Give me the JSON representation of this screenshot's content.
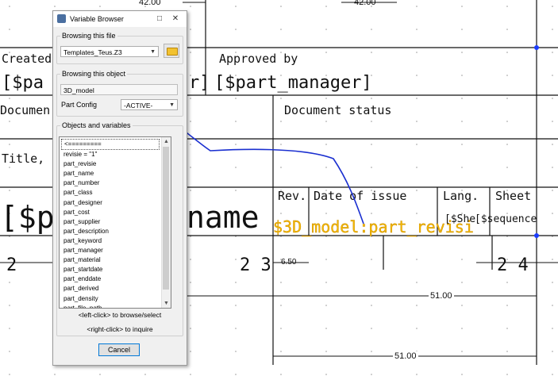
{
  "drawing": {
    "top_dims": [
      "42.00",
      "42.00"
    ],
    "created_label": "Created",
    "approved_label": "Approved by",
    "part_author_var": "[$pa",
    "bracket_r": "r]",
    "part_manager_var": "[$part_manager]",
    "document_type_label": "Documen",
    "document_status_label": "Document status",
    "title_label": "Title, Su",
    "rev_label": "Rev.",
    "date_issue_label": "Date of issue",
    "lang_label": "Lang.",
    "sheet_label": "Sheet",
    "name_prefix": "[$p",
    "name_suffix": "name",
    "lang_var": "[$She",
    "sheet_var": "[$sequence",
    "highlight_var": "$3D_model:part_revisi",
    "row_num_2": "2",
    "row_num_23": "2 3",
    "row_num_24": "2 4",
    "dim_650": "6.50",
    "dim_51a": "51.00",
    "dim_51b": "51.00"
  },
  "dialog": {
    "title": "Variable Browser",
    "browse_file_label": "Browsing this file",
    "file_value": "Templates_Teus.Z3",
    "browse_object_label": "Browsing this object",
    "object_value": "3D_model",
    "part_config_label": "Part Config",
    "part_config_value": "-ACTIVE-",
    "objects_label": "Objects and variables",
    "items": [
      "<=========",
      "revisie = \"1\"",
      "part_revisie",
      "part_name",
      "part_number",
      "part_class",
      "part_designer",
      "part_cost",
      "part_supplier",
      "part_description",
      "part_keyword",
      "part_manager",
      "part_material",
      "part_startdate",
      "part_enddate",
      "part_derived",
      "part_density",
      "part_file_path"
    ],
    "hint_left": "<left-click> to browse/select",
    "hint_right": "<right-click> to inquire",
    "cancel": "Cancel"
  },
  "colors": {
    "ink": "#111111",
    "annotation": "#1a2fd0",
    "highlight": "#f5b800",
    "grid_dot": "#9a9a9a"
  }
}
